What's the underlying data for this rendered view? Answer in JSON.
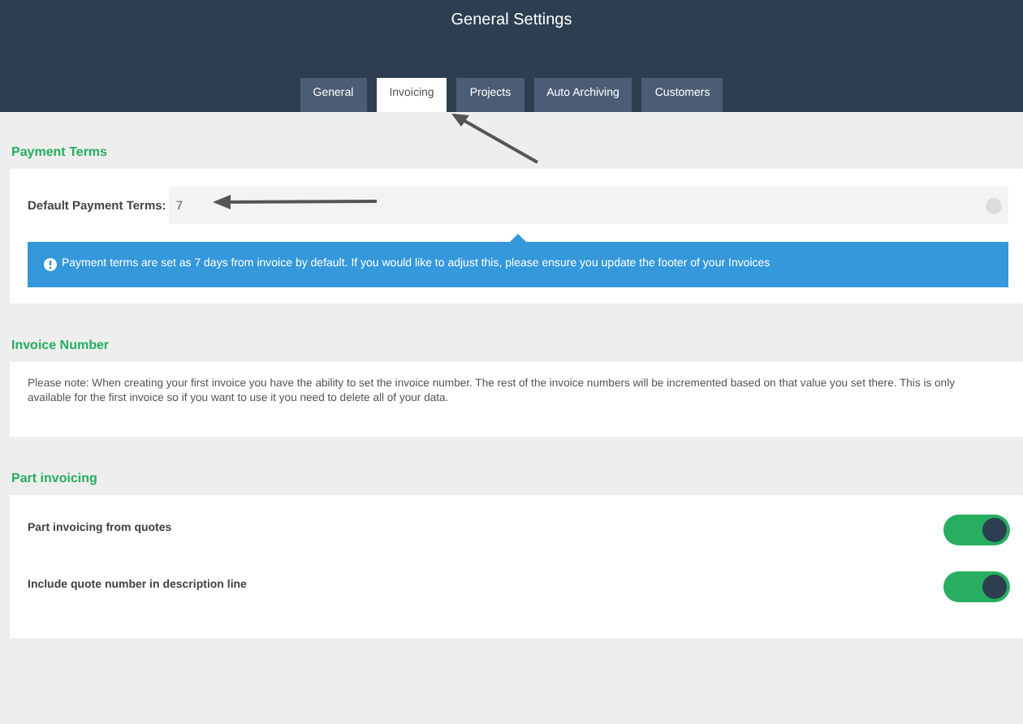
{
  "window": {
    "title": "General Settings"
  },
  "tabs": [
    {
      "label": "General",
      "selected": false
    },
    {
      "label": "Invoicing",
      "selected": true
    },
    {
      "label": "Projects",
      "selected": false
    },
    {
      "label": "Auto Archiving",
      "selected": false
    },
    {
      "label": "Customers",
      "selected": false
    }
  ],
  "payment_terms": {
    "heading": "Payment Terms",
    "field_label": "Default Payment Terms:",
    "value": "7",
    "info": "Payment terms are set as 7 days from invoice by default. If you would like to adjust this, please ensure you update the footer of your Invoices"
  },
  "invoice_number": {
    "heading": "Invoice Number",
    "note": "Please note: When creating your first invoice you have the ability to set the invoice number. The rest of the invoice numbers will be incremented based on that value you set there. This is only available for the first invoice so if you want to use it you need to delete all of your data."
  },
  "part_invoicing": {
    "heading": "Part invoicing",
    "options": [
      {
        "label": "Part invoicing from quotes",
        "on": true
      },
      {
        "label": "Include quote number in description line",
        "on": true
      }
    ]
  }
}
